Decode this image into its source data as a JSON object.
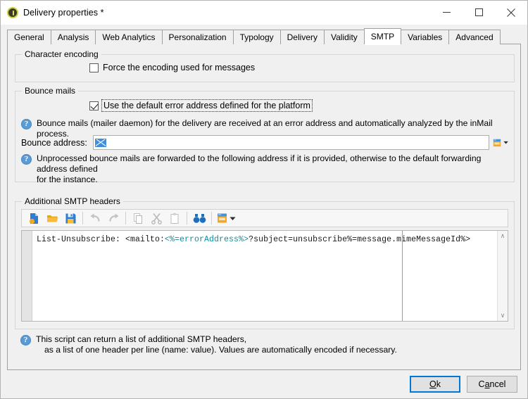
{
  "window": {
    "title": "Delivery properties *",
    "icon": "app-icon",
    "controls": [
      {
        "name": "minimize",
        "glyph": "–"
      },
      {
        "name": "maximize",
        "glyph": "□"
      },
      {
        "name": "close",
        "glyph": "✕"
      }
    ]
  },
  "tabs": [
    {
      "label": "General",
      "active": false
    },
    {
      "label": "Analysis",
      "active": false
    },
    {
      "label": "Web Analytics",
      "active": false
    },
    {
      "label": "Personalization",
      "active": false
    },
    {
      "label": "Typology",
      "active": false
    },
    {
      "label": "Delivery",
      "active": false
    },
    {
      "label": "Validity",
      "active": false
    },
    {
      "label": "SMTP",
      "active": true
    },
    {
      "label": "Variables",
      "active": false
    },
    {
      "label": "Advanced",
      "active": false
    }
  ],
  "character_encoding": {
    "legend": "Character encoding",
    "force_encoding_label": "Force the encoding used for messages",
    "force_encoding_checked": false
  },
  "bounce_mails": {
    "legend": "Bounce mails",
    "use_default_error_address_label": "Use the default error address defined for the platform",
    "use_default_error_address_checked": true,
    "info_1": "Bounce mails (mailer daemon) for the delivery are received at an error address and automatically analyzed by the inMail process.",
    "address_label": "Bounce address:",
    "address_value": "",
    "address_placeholder": "",
    "address_icon": "envelope-icon",
    "dropdown_icon": "form-picker-icon",
    "info_2_line1": "Unprocessed bounce mails are forwarded to the following address if it is provided, otherwise to the default forwarding address defined",
    "info_2_line2": "for the instance."
  },
  "smtp_headers": {
    "legend": "Additional SMTP headers",
    "toolbar": [
      {
        "name": "new-icon",
        "title": "New"
      },
      {
        "name": "open-icon",
        "title": "Open"
      },
      {
        "name": "save-icon",
        "title": "Save"
      },
      {
        "name": "undo-icon",
        "title": "Undo"
      },
      {
        "name": "redo-icon",
        "title": "Redo"
      },
      {
        "name": "copy-icon",
        "title": "Copy"
      },
      {
        "name": "cut-icon",
        "title": "Cut"
      },
      {
        "name": "paste-icon",
        "title": "Paste"
      },
      {
        "name": "find-icon",
        "title": "Find"
      },
      {
        "name": "insert-field-icon",
        "title": "Insert field"
      }
    ],
    "code": {
      "prefix": "List-Unsubscribe: <mailto:",
      "token": "<%=errorAddress%>",
      "suffix": "?subject=unsubscribe%=message.mimeMessageId%>"
    },
    "scroll_up": "∧",
    "scroll_down": "∨"
  },
  "help": {
    "line1": "This script can return a list of additional SMTP headers,",
    "line2": "as a list of one header per line (name: value). Values are automatically encoded if necessary."
  },
  "footer": {
    "ok_label": "Ok",
    "ok_accel": "O",
    "cancel_label": "Cancel",
    "cancel_accel": "a"
  },
  "colors": {
    "accent": "#0078d7",
    "info_blue": "#5b9bd5",
    "token_teal": "#0f8f9e",
    "orange": "#f0a030"
  }
}
